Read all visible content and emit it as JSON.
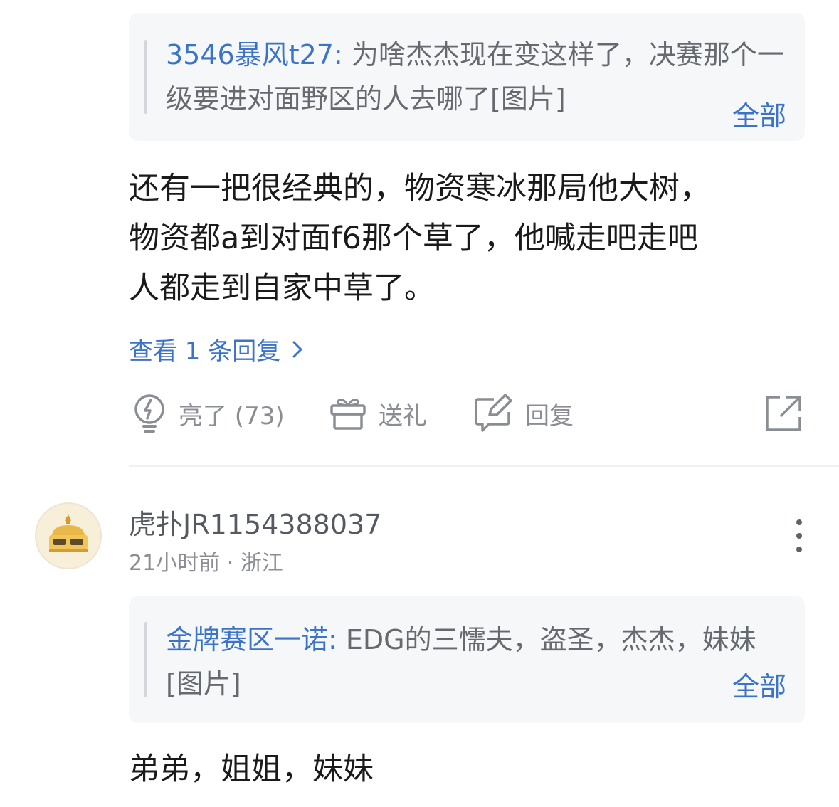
{
  "comment1": {
    "quote": {
      "author": "3546暴风t27:",
      "text": " 为啥杰杰现在变这样了，决赛那个一级要进对面野区的人去哪了[图片]",
      "more": "全部"
    },
    "lines": [
      "还有一把很经典的，物资寒冰那局他大树，",
      "物资都a到对面f6那个草了，他喊走吧走吧",
      "人都走到自家中草了。"
    ],
    "view_replies": "查看 1 条回复",
    "actions": {
      "like": "亮了 (73)",
      "gift": "送礼",
      "reply": "回复"
    },
    "icons": {
      "like": "lightbulb-icon",
      "gift": "gift-icon",
      "reply": "edit-reply-icon",
      "share": "share-icon",
      "chevron": "chevron-right-icon"
    }
  },
  "comment2": {
    "username": "虎扑JR1154388037",
    "meta": "21小时前 · 浙江",
    "quote": {
      "author": "金牌赛区一诺:",
      "text": " EDG的三懦夫，盗圣，杰杰，妹妹[图片]",
      "more": "全部"
    },
    "body": "弟弟，姐姐，妹妹"
  },
  "colors": {
    "link": "#3b73c8",
    "quote_bg": "#f6f7f9",
    "muted": "#8a8e94"
  }
}
